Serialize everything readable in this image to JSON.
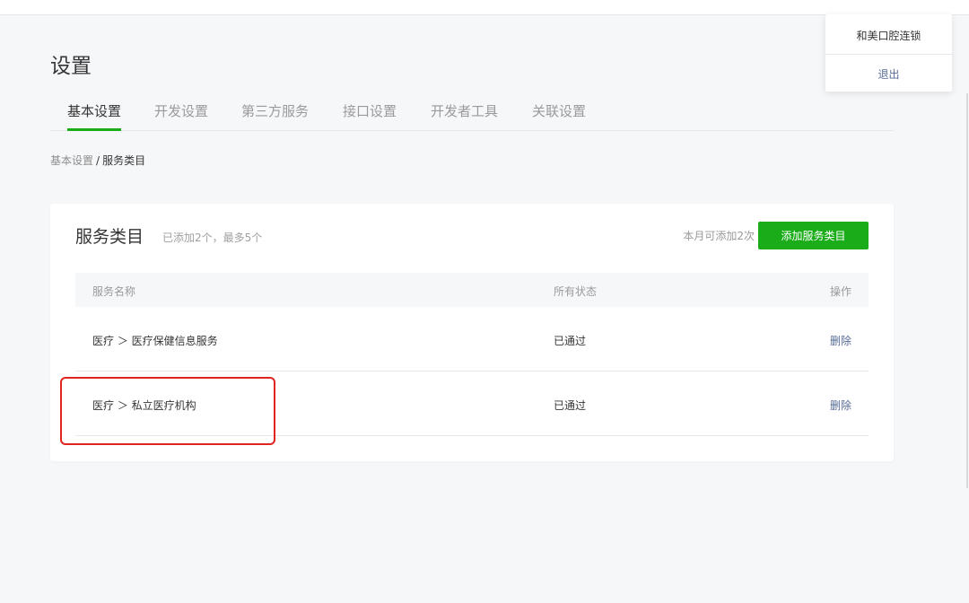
{
  "page": {
    "title": "设置"
  },
  "tabs": [
    {
      "label": "基本设置",
      "active": true
    },
    {
      "label": "开发设置",
      "active": false
    },
    {
      "label": "第三方服务",
      "active": false
    },
    {
      "label": "接口设置",
      "active": false
    },
    {
      "label": "开发者工具",
      "active": false
    },
    {
      "label": "关联设置",
      "active": false
    }
  ],
  "breadcrumb": {
    "parent": "基本设置",
    "separator": "/",
    "current": "服务类目"
  },
  "service_category": {
    "title": "服务类目",
    "summary": "已添加2个，最多5个",
    "monthly_quota": "本月可添加2次",
    "add_button_label": "添加服务类目",
    "table": {
      "columns": [
        "服务名称",
        "所有状态",
        "操作"
      ],
      "rows": [
        {
          "name": "医疗 ＞ 医疗保健信息服务",
          "status": "已通过",
          "action": "删除"
        },
        {
          "name": "医疗 ＞ 私立医疗机构",
          "status": "已通过",
          "action": "删除"
        }
      ]
    }
  },
  "account_menu": {
    "account_name": "和美口腔连锁",
    "logout_label": "退出"
  },
  "colors": {
    "accent": "#1aad19",
    "link": "#576b95",
    "highlight": "#e0251f",
    "background": "#f6f7f9"
  }
}
